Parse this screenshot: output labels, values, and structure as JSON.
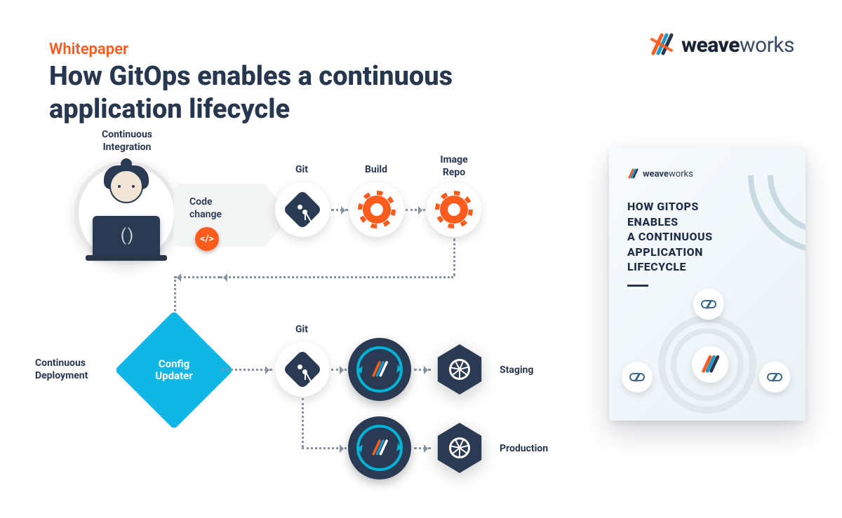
{
  "brand": {
    "bold": "weave",
    "light": "works"
  },
  "eyebrow": "Whitepaper",
  "headline": "How GitOps enables a continuous application lifecycle",
  "diagram": {
    "ci_label": "Continuous\nIntegration",
    "cd_label": "Continuous\nDeployment",
    "code_change": "Code\nchange",
    "code_glyph": "</>",
    "git": "Git",
    "build": "Build",
    "image_repo": "Image\nRepo",
    "config_updater": "Config\nUpdater",
    "staging": "Staging",
    "production": "Production"
  },
  "cover": {
    "title_l1": "HOW GITOPS",
    "title_l2": "ENABLES",
    "title_l3": "A CONTINUOUS",
    "title_l4": "APPLICATION",
    "title_l5": "LIFECYCLE"
  }
}
